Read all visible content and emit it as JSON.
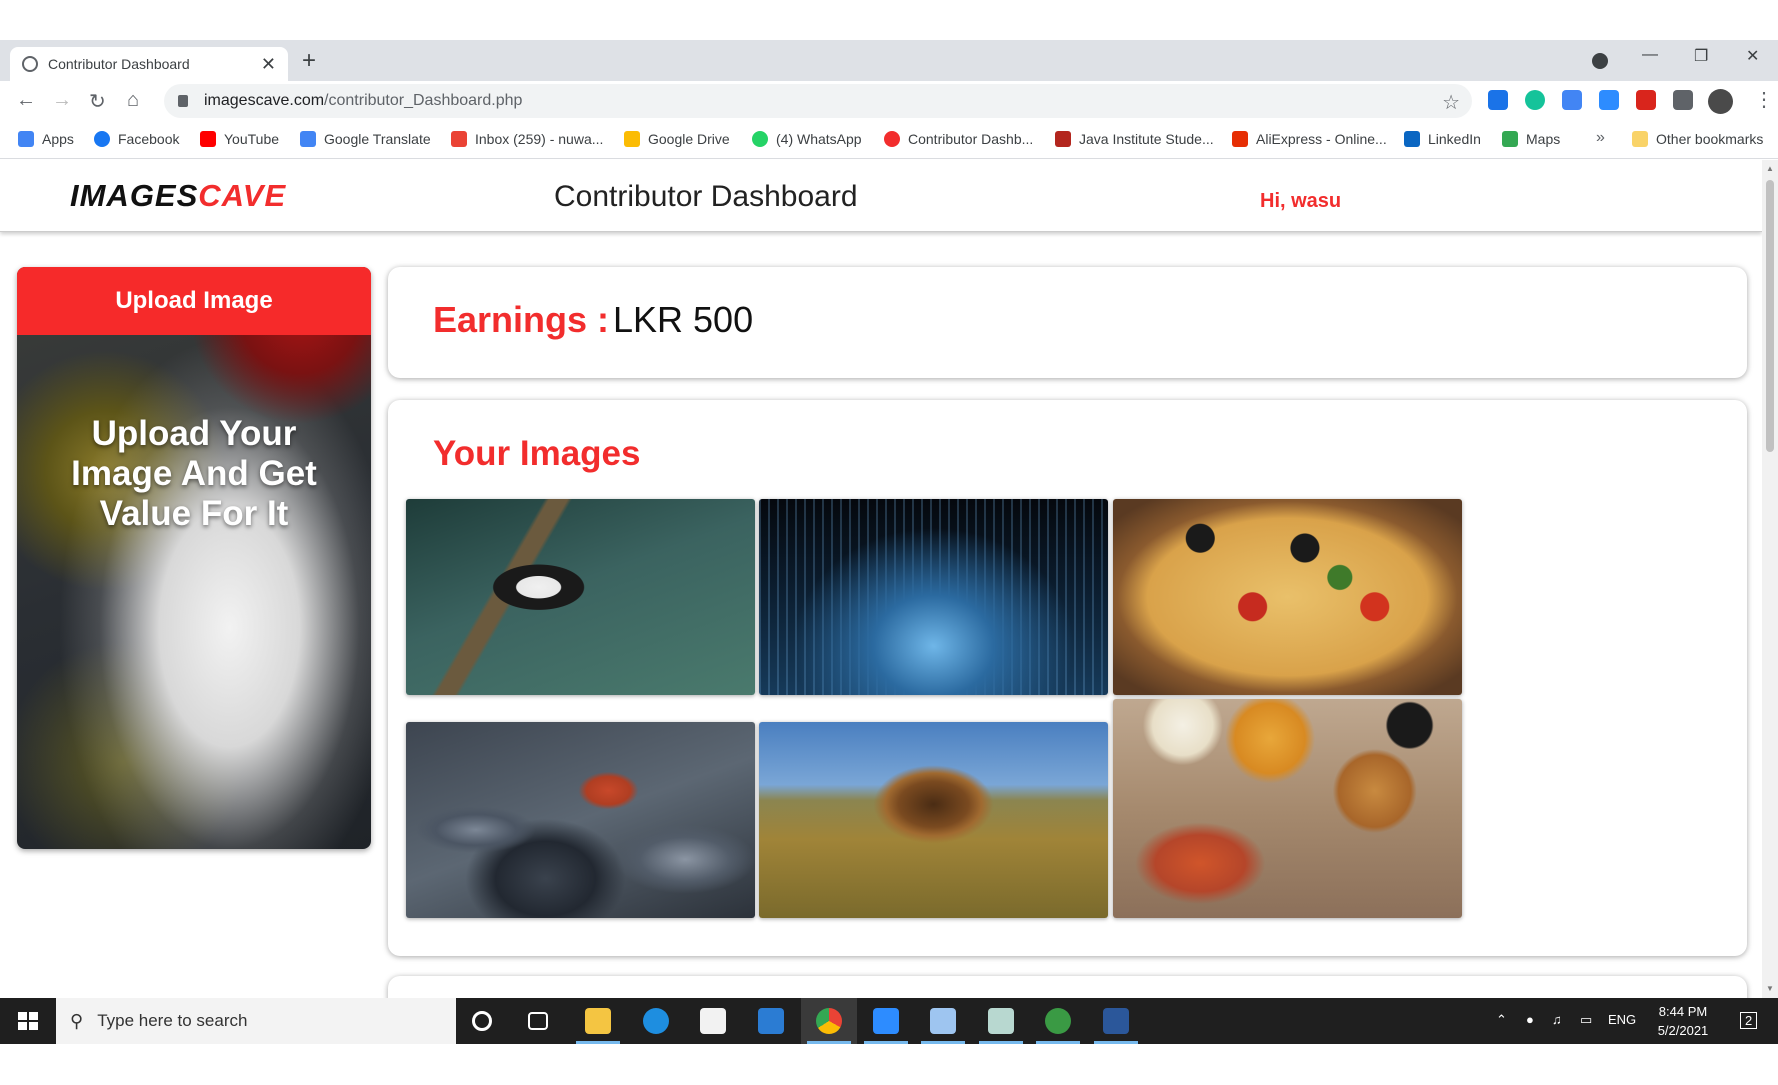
{
  "browser": {
    "tab_title": "Contributor Dashboard",
    "tab_close": "✕",
    "new_tab": "+",
    "url_host": "imagescave.com",
    "url_path": "/contributor_Dashboard.php",
    "bookmarks": [
      {
        "label": "Apps",
        "color": "#4285f4"
      },
      {
        "label": "Facebook",
        "color": "#1877f2"
      },
      {
        "label": "YouTube",
        "color": "#ff0000"
      },
      {
        "label": "Google Translate",
        "color": "#4285f4"
      },
      {
        "label": "Inbox (259) - nuwa...",
        "color": "#ea4335"
      },
      {
        "label": "Google Drive",
        "color": "#fbbc04"
      },
      {
        "label": "(4) WhatsApp",
        "color": "#25d366"
      },
      {
        "label": "Contributor Dashb...",
        "color": "#f22d2d"
      },
      {
        "label": "Java Institute Stude...",
        "color": "#b3261e"
      },
      {
        "label": "AliExpress - Online...",
        "color": "#e62e04"
      },
      {
        "label": "LinkedIn",
        "color": "#0a66c2"
      },
      {
        "label": "Maps",
        "color": "#34a853"
      }
    ],
    "more_bookmarks": "»",
    "other_bookmarks": "Other bookmarks"
  },
  "site": {
    "logo_part1": "IMAGES",
    "logo_part2": "CAVE",
    "header_title": "Contributor Dashboard",
    "greeting": "Hi, wasu",
    "upload_button": "Upload Image",
    "upload_banner_text": "Upload Your Image And Get Value For It",
    "earnings_label": "Earnings :",
    "earnings_value": "LKR 500",
    "images_title": "Your Images",
    "images": [
      "panda",
      "city-night",
      "pizza",
      "pebbles",
      "lion",
      "fast-food"
    ]
  },
  "taskbar": {
    "search_placeholder": "Type here to search",
    "language": "ENG",
    "time": "8:44 PM",
    "date": "5/2/2021",
    "notifications": "2"
  },
  "colors": {
    "brand_red": "#f22d2d",
    "chrome_frame": "#dee1e6"
  }
}
